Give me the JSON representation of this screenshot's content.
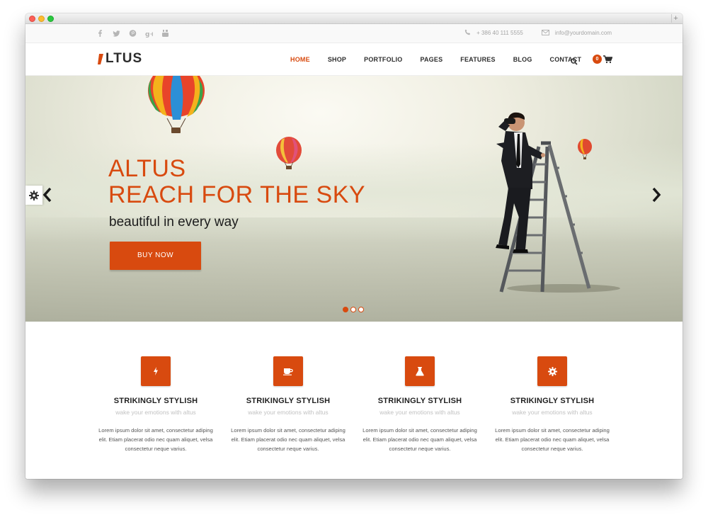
{
  "browser": {
    "new_tab_label": "+"
  },
  "topbar": {
    "social_icons": [
      "facebook-icon",
      "twitter-icon",
      "pinterest-icon",
      "google-plus-icon",
      "youtube-icon"
    ],
    "phone": "+ 386 40 111 5555",
    "email": "info@yourdomain.com"
  },
  "navbar": {
    "logo_text": "LTUS",
    "menu": [
      {
        "label": "HOME",
        "active": true
      },
      {
        "label": "SHOP"
      },
      {
        "label": "PORTFOLIO"
      },
      {
        "label": "PAGES"
      },
      {
        "label": "FEATURES"
      },
      {
        "label": "BLOG"
      },
      {
        "label": "CONTACT"
      }
    ],
    "cart_count": "0"
  },
  "hero": {
    "title_line1": "ALTUS",
    "title_line2": "REACH FOR THE SKY",
    "subtitle": "beautiful in every way",
    "button_label": "BUY NOW",
    "slides_total": 3,
    "active_slide": 1
  },
  "features": [
    {
      "icon": "bolt-icon",
      "title": "STRIKINGLY STYLISH",
      "subtitle": "wake your emotions with altus",
      "text": "Lorem ipsum dolor sit amet, consectetur adiping elit. Etiam placerat odio nec quam aliquet, velsa consectetur neque varius."
    },
    {
      "icon": "coffee-cup-icon",
      "title": "STRIKINGLY STYLISH",
      "subtitle": "wake your emotions with altus",
      "text": "Lorem ipsum dolor sit amet, consectetur adiping elit. Etiam placerat odio nec quam aliquet, velsa consectetur neque varius."
    },
    {
      "icon": "flask-icon",
      "title": "STRIKINGLY STYLISH",
      "subtitle": "wake your emotions with altus",
      "text": "Lorem ipsum dolor sit amet, consectetur adiping elit. Etiam placerat odio nec quam aliquet, velsa consectetur neque varius."
    },
    {
      "icon": "gear-icon",
      "title": "STRIKINGLY STYLISH",
      "subtitle": "wake your emotions with altus",
      "text": "Lorem ipsum dolor sit amet, consectetur adiping elit. Etiam placerat odio nec quam aliquet, velsa consectetur neque varius."
    }
  ],
  "colors": {
    "accent": "#d84a0f",
    "text_dark": "#1f1f1f",
    "muted": "#c2c2c2"
  }
}
